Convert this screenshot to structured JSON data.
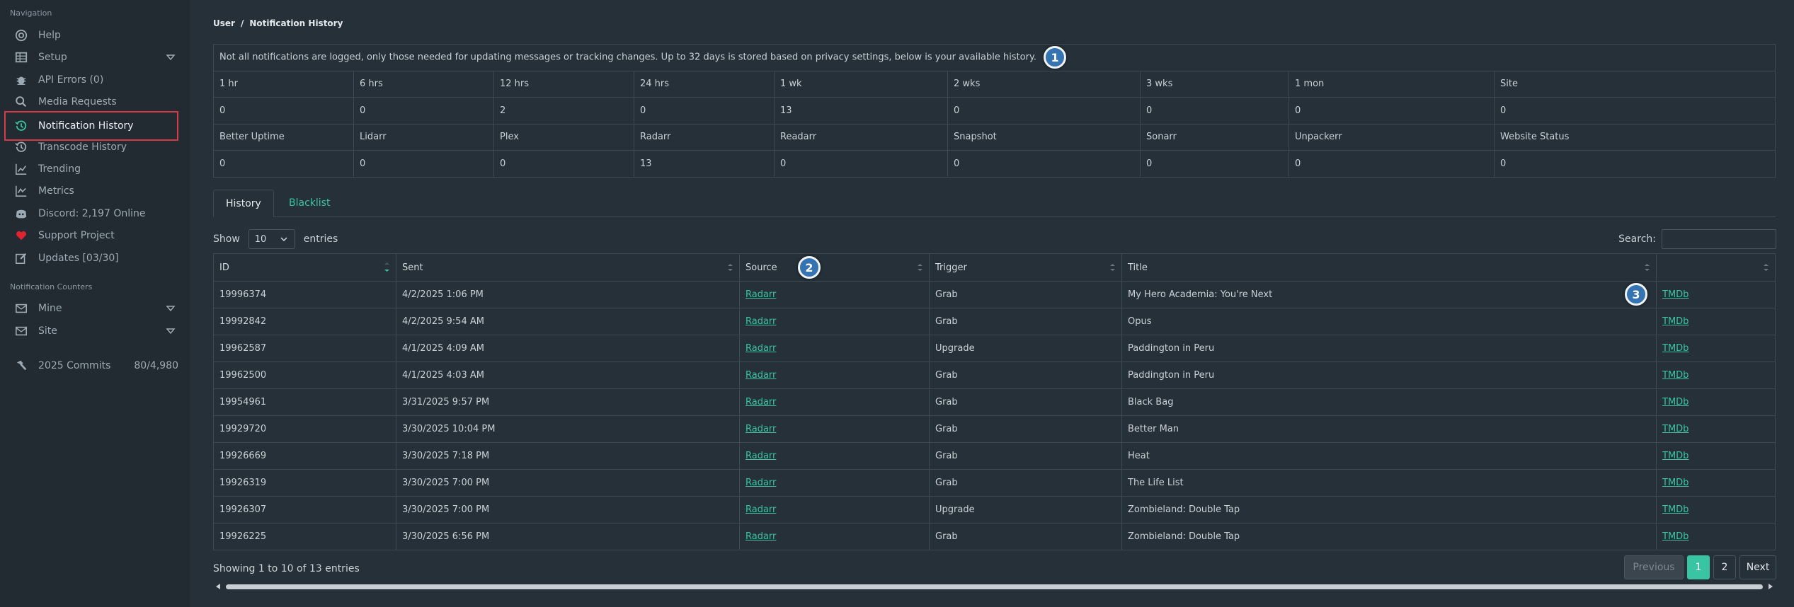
{
  "sidebar": {
    "nav_heading": "Navigation",
    "items": [
      {
        "label": "Help",
        "icon": "help-circle-icon"
      },
      {
        "label": "Setup",
        "icon": "grid-icon"
      },
      {
        "label": "API Errors (0)",
        "icon": "bug-icon"
      },
      {
        "label": "Media Requests",
        "icon": "search-icon"
      },
      {
        "label": "Notification History",
        "icon": "history-icon"
      },
      {
        "label": "Transcode History",
        "icon": "history-icon"
      },
      {
        "label": "Trending",
        "icon": "chart-line-icon"
      },
      {
        "label": "Metrics",
        "icon": "chart-line-icon"
      },
      {
        "label": "Discord: 2,197 Online",
        "icon": "discord-icon"
      },
      {
        "label": "Support Project",
        "icon": "heart-icon"
      },
      {
        "label": "Updates [03/30]",
        "icon": "edit-icon"
      }
    ],
    "counters_heading": "Notification Counters",
    "counters": [
      {
        "label": "Mine",
        "icon": "envelope-icon"
      },
      {
        "label": "Site",
        "icon": "envelope-icon"
      }
    ],
    "commits": {
      "label": "2025 Commits",
      "count": "80/4,980",
      "icon": "hammer-icon"
    }
  },
  "breadcrumb": {
    "parent": "User",
    "separator": "/",
    "current": "Notification History"
  },
  "notice": "Not all notifications are logged, only those needed for updating messages or tracking changes. Up to 32 days is stored based on privacy settings, below is your available history.",
  "badges": {
    "one": "1",
    "two": "2",
    "three": "3"
  },
  "period_headers": [
    "1 hr",
    "6 hrs",
    "12 hrs",
    "24 hrs",
    "1 wk",
    "2 wks",
    "3 wks",
    "1 mon",
    "Site"
  ],
  "period_values": [
    "0",
    "0",
    "2",
    "0",
    "13",
    "0",
    "0",
    "0",
    "0"
  ],
  "source_headers": [
    "Better Uptime",
    "Lidarr",
    "Plex",
    "Radarr",
    "Readarr",
    "Snapshot",
    "Sonarr",
    "Unpackerr",
    "Website Status"
  ],
  "source_values": [
    "0",
    "0",
    "0",
    "13",
    "0",
    "0",
    "0",
    "0",
    "0"
  ],
  "tabs": [
    "History",
    "Blacklist"
  ],
  "length": {
    "show": "Show",
    "value": "10",
    "entries": "entries"
  },
  "search_label": "Search:",
  "columns": [
    "ID",
    "Sent",
    "Source",
    "Trigger",
    "Title",
    ""
  ],
  "rows": [
    {
      "id": "19996374",
      "sent": "4/2/2025 1:06 PM",
      "source": "Radarr",
      "trigger": "Grab",
      "title": "My Hero Academia: You're Next",
      "link": "TMDb"
    },
    {
      "id": "19992842",
      "sent": "4/2/2025 9:54 AM",
      "source": "Radarr",
      "trigger": "Grab",
      "title": "Opus",
      "link": "TMDb"
    },
    {
      "id": "19962587",
      "sent": "4/1/2025 4:09 AM",
      "source": "Radarr",
      "trigger": "Upgrade",
      "title": "Paddington in Peru",
      "link": "TMDb"
    },
    {
      "id": "19962500",
      "sent": "4/1/2025 4:03 AM",
      "source": "Radarr",
      "trigger": "Grab",
      "title": "Paddington in Peru",
      "link": "TMDb"
    },
    {
      "id": "19954961",
      "sent": "3/31/2025 9:57 PM",
      "source": "Radarr",
      "trigger": "Grab",
      "title": "Black Bag",
      "link": "TMDb"
    },
    {
      "id": "19929720",
      "sent": "3/30/2025 10:04 PM",
      "source": "Radarr",
      "trigger": "Grab",
      "title": "Better Man",
      "link": "TMDb"
    },
    {
      "id": "19926669",
      "sent": "3/30/2025 7:18 PM",
      "source": "Radarr",
      "trigger": "Grab",
      "title": "Heat",
      "link": "TMDb"
    },
    {
      "id": "19926319",
      "sent": "3/30/2025 7:00 PM",
      "source": "Radarr",
      "trigger": "Grab",
      "title": "The Life List",
      "link": "TMDb"
    },
    {
      "id": "19926307",
      "sent": "3/30/2025 7:00 PM",
      "source": "Radarr",
      "trigger": "Upgrade",
      "title": "Zombieland: Double Tap",
      "link": "TMDb"
    },
    {
      "id": "19926225",
      "sent": "3/30/2025 6:56 PM",
      "source": "Radarr",
      "trigger": "Grab",
      "title": "Zombieland: Double Tap",
      "link": "TMDb"
    }
  ],
  "info": "Showing 1 to 10 of 13 entries",
  "pagination": {
    "previous": "Previous",
    "pages": [
      "1",
      "2"
    ],
    "next": "Next"
  },
  "colors": {
    "accent": "#39c4a3",
    "highlight_border": "#d63a45",
    "badge": "#3673b2",
    "heart": "#e0232f"
  }
}
